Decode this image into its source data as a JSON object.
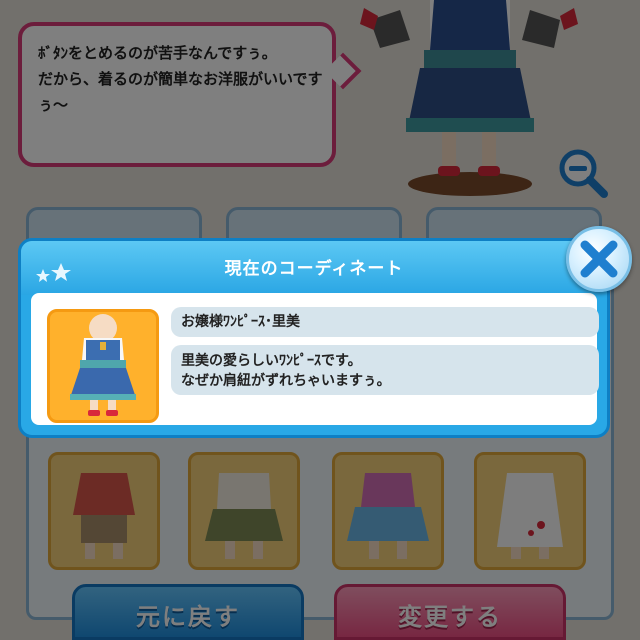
{
  "dialogue": {
    "text": "ﾎﾞﾀﾝをとめるのが苦手なんですぅ。\nだから、着るのが簡単なお洋服がいいですぅ〜"
  },
  "buttons": {
    "reset_label": "元に戻す",
    "change_label": "変更する"
  },
  "modal": {
    "title": "現在のコーディネート",
    "item_name": "お嬢様ﾜﾝﾋﾟｰｽ･里美",
    "item_description": "里美の愛らしいﾜﾝﾋﾟｰｽです。\nなぜか肩紐がずれちゃいますぅ。"
  },
  "icons": {
    "close": "close-x-icon",
    "zoom": "zoom-out-icon",
    "stars": "stars-icon"
  },
  "colors": {
    "accent_blue": "#29a8e6",
    "accent_pink": "#ef4f84",
    "bubble_border": "#d93a78"
  }
}
